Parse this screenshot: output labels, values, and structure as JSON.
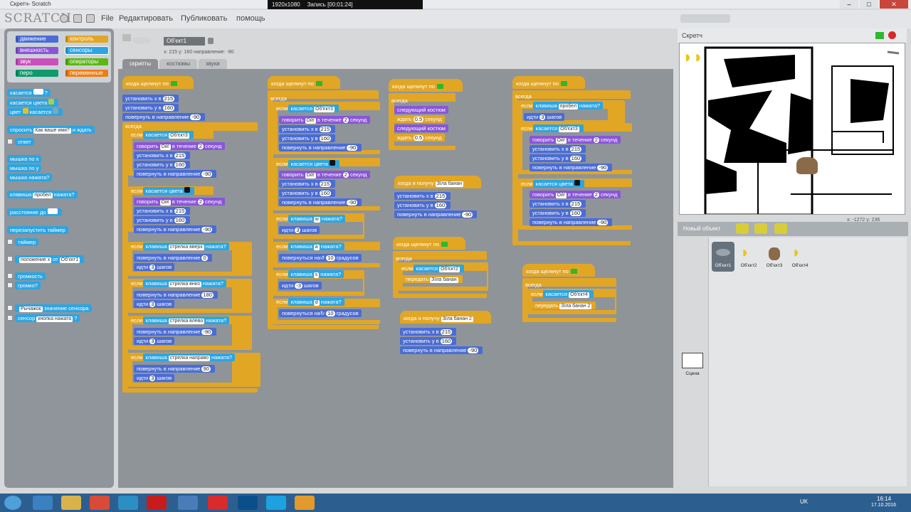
{
  "window": {
    "title": "Скретч- Scratch",
    "recorder": {
      "resolution": "1920x1080",
      "status": "Запись [00:01:24]"
    }
  },
  "menu": {
    "logo": "SCRATCH",
    "items": [
      "File",
      "Редактировать",
      "Публиковать",
      "помощь"
    ]
  },
  "categories": [
    {
      "label": "движение",
      "color": "#4a6cd4"
    },
    {
      "label": "контроль",
      "color": "#e2a625"
    },
    {
      "label": "внешность",
      "color": "#8a55d7"
    },
    {
      "label": "сенсоры",
      "color": "#2ca5e2"
    },
    {
      "label": "звук",
      "color": "#c94fbd"
    },
    {
      "label": "операторы",
      "color": "#5cb712"
    },
    {
      "label": "перо",
      "color": "#0e9a6c"
    },
    {
      "label": "переменные",
      "color": "#ee7d16"
    }
  ],
  "palette_blocks": [
    "касается",
    "касается цвета",
    "цвет",
    "касается",
    "спросить",
    "Как ваше имя?",
    "и ждать",
    "ответ",
    "мышка по x",
    "мышка по y",
    "мышка нажата?",
    "клавиша",
    "пробел",
    "нажата?",
    "расстояние до",
    "перезапустить таймер",
    "таймер",
    "положение x",
    "от",
    "Об'єкт1",
    "громкость",
    "громко?",
    "Рычажок",
    "значение сенсора",
    "сенсор",
    "кнопка нажата",
    "?"
  ],
  "sprite": {
    "name": "Об'єкт1",
    "coords": "x: 215  y: 160  направление: -90"
  },
  "tabs": [
    "скрипты",
    "костюмы",
    "звуки"
  ],
  "scripts": {
    "s1": {
      "hat": "когда щелкнут по",
      "setx": "установить x в",
      "x": "215",
      "sety": "установить y в",
      "y": "160",
      "dir": "повернуть в направление",
      "d": "-90",
      "forever": "всегда",
      "if": "если",
      "touching": "касается",
      "obj3": "Об'єкт3",
      "say": "говорить",
      "oi": "Ой!",
      "for": "в течение",
      "two": "2",
      "sec": "секунд",
      "touchcolor": "касается цвета",
      "key": "клавиша",
      "up": "стрелка вверх",
      "pressed": "нажата?",
      "zero": "0",
      "move": "идти",
      "three": "3",
      "steps": "шагов",
      "down": "стрелка вниз",
      "d180": "180",
      "left": "стрелка влево",
      "dm90": "-90",
      "right": "стрелка направо",
      "d90": "90"
    },
    "s2": {
      "hat": "когда щелкнут по",
      "forever": "всегда",
      "if": "если",
      "touching": "касается",
      "obj3": "Об'єкт3",
      "say": "говорить",
      "oi": "Ой!",
      "for": "в течение",
      "two": "2",
      "sec": "секунд",
      "setx": "установить x в",
      "x": "215",
      "sety": "установить y в",
      "y": "160",
      "dir": "повернуть в направление",
      "d": "-90",
      "touchcolor": "касается цвета",
      "key": "клавиша",
      "w": "w",
      "pressed": "нажата?",
      "move": "идти",
      "three": "3",
      "steps": "шагов",
      "a": "a",
      "turn": "повернуться на",
      "ten": "10",
      "deg": "градусов",
      "s": "s",
      "m3": "-3",
      "dd": "d"
    },
    "s3": {
      "hat": "когда щелкнут по",
      "forever": "всегда",
      "next": "следующий костюм",
      "wait": "ждать",
      "half": "0.5",
      "sec": "секунд"
    },
    "s4": {
      "hat": "когда я получу",
      "msg": "Зїла банан",
      "setx": "установить x в",
      "x": "215",
      "sety": "установить y в",
      "y": "160",
      "dir": "повернуть в направление",
      "d": "-90"
    },
    "s5": {
      "hat": "когда щелкнут по",
      "forever": "всегда",
      "if": "если",
      "touching": "касается",
      "obj2": "Об'єкт2",
      "broadcast": "передать",
      "msg": "Зїла банан"
    },
    "s6": {
      "hat": "когда я получу",
      "msg": "Зїла банан 2",
      "setx": "установить x в",
      "x": "215",
      "sety": "установить y в",
      "y": "160",
      "dir": "повернуть в направление",
      "d": "-90"
    },
    "s7": {
      "hat": "когда щелкнут по",
      "forever": "всегда",
      "if": "если",
      "key": "клавиша",
      "space": "пробел",
      "pressed": "нажата?",
      "move": "идти",
      "three": "3",
      "steps": "шагов",
      "touching": "касается",
      "obj3": "Об'єкт3",
      "say": "говорить",
      "oi": "Ой!",
      "for": "в течение",
      "two": "2",
      "sec": "секунд",
      "setx": "установить x в",
      "x": "215",
      "sety": "установить y в",
      "y": "160",
      "dir": "повернуть в направление",
      "d": "-90",
      "touchcolor": "касается цвета"
    },
    "s8": {
      "hat": "когда щелкнут по",
      "forever": "всегда",
      "if": "если",
      "touching": "касается",
      "obj4": "Об'єкт4",
      "broadcast": "передать",
      "msg": "Зїла банан 2"
    }
  },
  "stage": {
    "title": "Скретч",
    "mouse": "x: -1272  y: 236"
  },
  "sprites_panel": {
    "title": "Новый объект",
    "sprites": [
      "Об'єкт1",
      "Об'єкт2",
      "Об'єкт3",
      "Об'єкт4"
    ],
    "stage_label": "Сцена"
  },
  "taskbar": {
    "lang": "UK",
    "time": "16:14",
    "date": "17.10.2016"
  }
}
